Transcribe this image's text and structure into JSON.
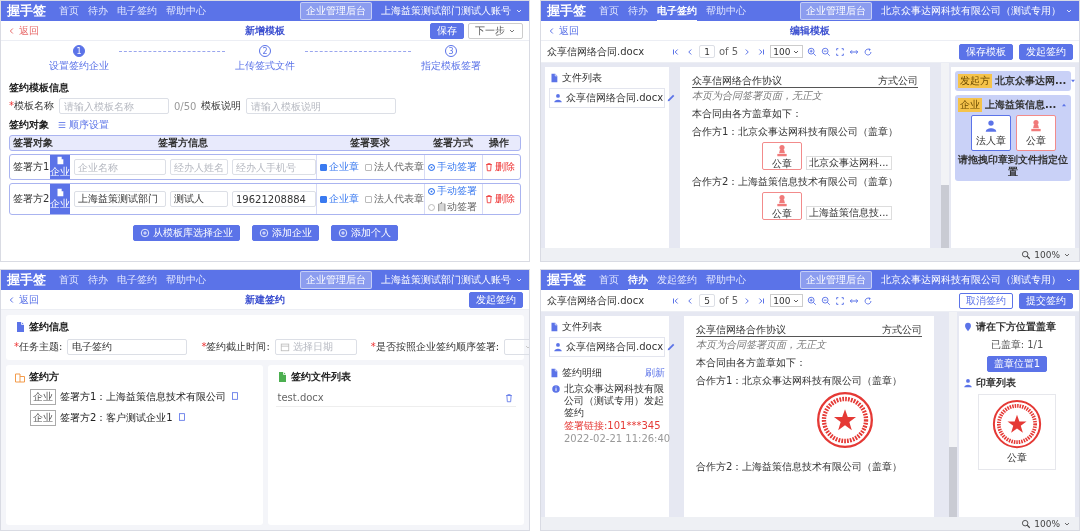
{
  "panels": [
    {
      "kind": "template_setup",
      "nav": {
        "logo": "握手签",
        "items": [
          {
            "label": "首页",
            "selected": false
          },
          {
            "label": "待办",
            "selected": false
          },
          {
            "label": "电子签约",
            "selected": false
          },
          {
            "label": "帮助中心",
            "selected": false
          }
        ],
        "admin_button": "企业管理后台",
        "account": "上海益策测试部门测试人账号"
      },
      "back": "返回",
      "title": "新增模板",
      "header_buttons": [
        {
          "label": "保存",
          "kind": "primary"
        },
        {
          "label": "下一步",
          "kind": "dropdown"
        }
      ],
      "steps": [
        {
          "number": "1",
          "label": "设置签约企业",
          "active": true
        },
        {
          "number": "2",
          "label": "上传签式文件",
          "active": false
        },
        {
          "number": "3",
          "label": "指定模板签署",
          "active": false
        }
      ],
      "info_section": {
        "title": "签约模板信息",
        "fields": [
          {
            "required_mark": "*",
            "label": "模板名称",
            "placeholder": "请输入模板名称",
            "counter": "0/50"
          },
          {
            "label": "模板说明",
            "placeholder": "请输入模板说明"
          }
        ]
      },
      "party_section": {
        "title": "签约对象",
        "link": "顺序设置"
      },
      "table": {
        "columns": [
          "签署对象",
          "签署方信息",
          "签署要求",
          "签署方式",
          "操作"
        ],
        "rows": [
          {
            "party": "签署方1",
            "badge": "企业",
            "inputs": [
              {
                "placeholder": "企业名称"
              },
              {
                "placeholder": "经办人姓名"
              },
              {
                "placeholder": "经办人手机号"
              }
            ],
            "requirements": [
              {
                "label": "企业章",
                "checked": true
              },
              {
                "label": "法人代表章",
                "checked": false
              }
            ],
            "methods": [
              {
                "label": "手动签署",
                "selected": true
              }
            ],
            "action": "删除"
          },
          {
            "party": "签署方2",
            "badge": "企业",
            "inputs": [
              {
                "value": "上海益策测试部门"
              },
              {
                "value": "测试人"
              },
              {
                "value": "19621208884"
              }
            ],
            "requirements": [
              {
                "label": "企业章",
                "checked": true
              },
              {
                "label": "法人代表章",
                "checked": false
              }
            ],
            "methods": [
              {
                "label": "手动签署",
                "selected": true
              },
              {
                "label": "自动签署",
                "selected": false
              }
            ],
            "action": "删除"
          }
        ]
      },
      "footer_buttons": [
        "从模板库选择企业",
        "添加企业",
        "添加个人"
      ]
    },
    {
      "kind": "template_edit",
      "nav": {
        "logo": "握手签",
        "items": [
          {
            "label": "首页",
            "selected": false
          },
          {
            "label": "待办",
            "selected": false
          },
          {
            "label": "电子签约",
            "selected": true
          },
          {
            "label": "帮助中心",
            "selected": false
          }
        ],
        "admin_button": "企业管理后台",
        "account": "北京众事达网科技有限公司（测试专用）"
      },
      "back": "返回",
      "title": "编辑模板",
      "toolbar": {
        "filename": "众享信网络合同.docx",
        "page": "1",
        "page_total": "of 5",
        "zoom": "100",
        "buttons": [
          {
            "label": "保存模板",
            "kind": "primary"
          },
          {
            "label": "发起签约",
            "kind": "primary"
          }
        ]
      },
      "file_list": {
        "title": "文件列表",
        "files": [
          "众享信网络合同.docx"
        ]
      },
      "document": {
        "header_left": "众享信网络合作协议",
        "header_right": "方式公司",
        "note": "本页为合同签署页面，无正文",
        "intro": "本合同由各方盖章如下：",
        "parties": [
          {
            "text": "合作方1：北京众事达网科技有限公司（盖章）",
            "seal_slot": {
              "label": "公章",
              "caption": "北京众事达网科..."
            }
          },
          {
            "text": "合作方2：上海益策信息技术有限公司（盖章）",
            "seal_slot": {
              "label": "公章",
              "caption": "上海益策信息技..."
            }
          }
        ]
      },
      "signers": [
        {
          "tag": "发起方",
          "name": "北京众事达网...",
          "expanded": false
        },
        {
          "tag": "企业",
          "name": "上海益策信息...",
          "expanded": true,
          "seals": [
            {
              "kind": "legal_person",
              "label": "法人章"
            },
            {
              "kind": "company",
              "label": "公章"
            }
          ],
          "hint": "请拖拽印章到文件指定位置"
        }
      ],
      "zoom_status": "100%"
    },
    {
      "kind": "new_signing",
      "nav": {
        "logo": "握手签",
        "items": [
          {
            "label": "首页",
            "selected": false
          },
          {
            "label": "待办",
            "selected": false
          },
          {
            "label": "电子签约",
            "selected": false
          },
          {
            "label": "帮助中心",
            "selected": false
          }
        ],
        "admin_button": "企业管理后台",
        "account": "上海益策测试部门测试人账号"
      },
      "back": "返回",
      "title": "新建签约",
      "header_buttons": [
        {
          "label": "发起签约",
          "kind": "primary"
        }
      ],
      "info_card": {
        "title": "签约信息",
        "fields": [
          {
            "required_mark": "*",
            "label": "任务主题:",
            "kind": "text",
            "value": "电子签约"
          },
          {
            "required_mark": "*",
            "label": "签约截止时间:",
            "kind": "date",
            "placeholder": "选择日期"
          },
          {
            "required_mark": "*",
            "label": "是否按照企业签约顺序签署:",
            "kind": "select"
          }
        ]
      },
      "parties_card": {
        "title": "签约方",
        "parties": [
          {
            "tag": "企业",
            "text": "签署方1：上海益策信息技术有限公司"
          },
          {
            "tag": "企业",
            "text": "签署方2：客户测试企业1"
          }
        ]
      },
      "files_card": {
        "title": "签约文件列表",
        "files": [
          "test.docx"
        ]
      }
    },
    {
      "kind": "sign_document",
      "nav": {
        "logo": "握手签",
        "items": [
          {
            "label": "首页",
            "selected": false
          },
          {
            "label": "待办",
            "selected": true
          },
          {
            "label": "发起签约",
            "selected": false
          },
          {
            "label": "帮助中心",
            "selected": false
          }
        ],
        "admin_button": "企业管理后台",
        "account": "北京众事达网科技有限公司（测试专用）"
      },
      "toolbar": {
        "filename": "众享信网络合同.docx",
        "page": "5",
        "page_total": "of 5",
        "zoom": "100",
        "buttons": [
          {
            "label": "取消签约",
            "kind": "outline"
          },
          {
            "label": "提交签约",
            "kind": "primary"
          }
        ]
      },
      "file_list": {
        "title": "文件列表",
        "files": [
          "众享信网络合同.docx"
        ]
      },
      "details": {
        "title": "签约明细",
        "link": "刷新",
        "entries": [
          {
            "text": "北京众事达网科技有限公司（测试专用）发起签约",
            "status": "签署链接:101***345",
            "time": "2022-02-21 11:26:40"
          }
        ]
      },
      "document": {
        "header_left": "众享信网络合作协议",
        "header_right": "方式公司",
        "note": "本页为合同签署页面，无正文",
        "intro": "本合同由各方盖章如下：",
        "parties": [
          {
            "text": "合作方1：北京众事达网科技有限公司（盖章）",
            "stamped": true
          },
          {
            "text": "合作方2：上海益策信息技术有限公司（盖章）",
            "stamped": false
          }
        ]
      },
      "stamp_panel": {
        "title": "请在下方位置盖章",
        "count": "已盖章: 1/1",
        "position_button": "盖章位置1",
        "list_title": "印章列表",
        "seals": [
          {
            "label": "公章"
          }
        ]
      },
      "zoom_status": "100%"
    }
  ]
}
